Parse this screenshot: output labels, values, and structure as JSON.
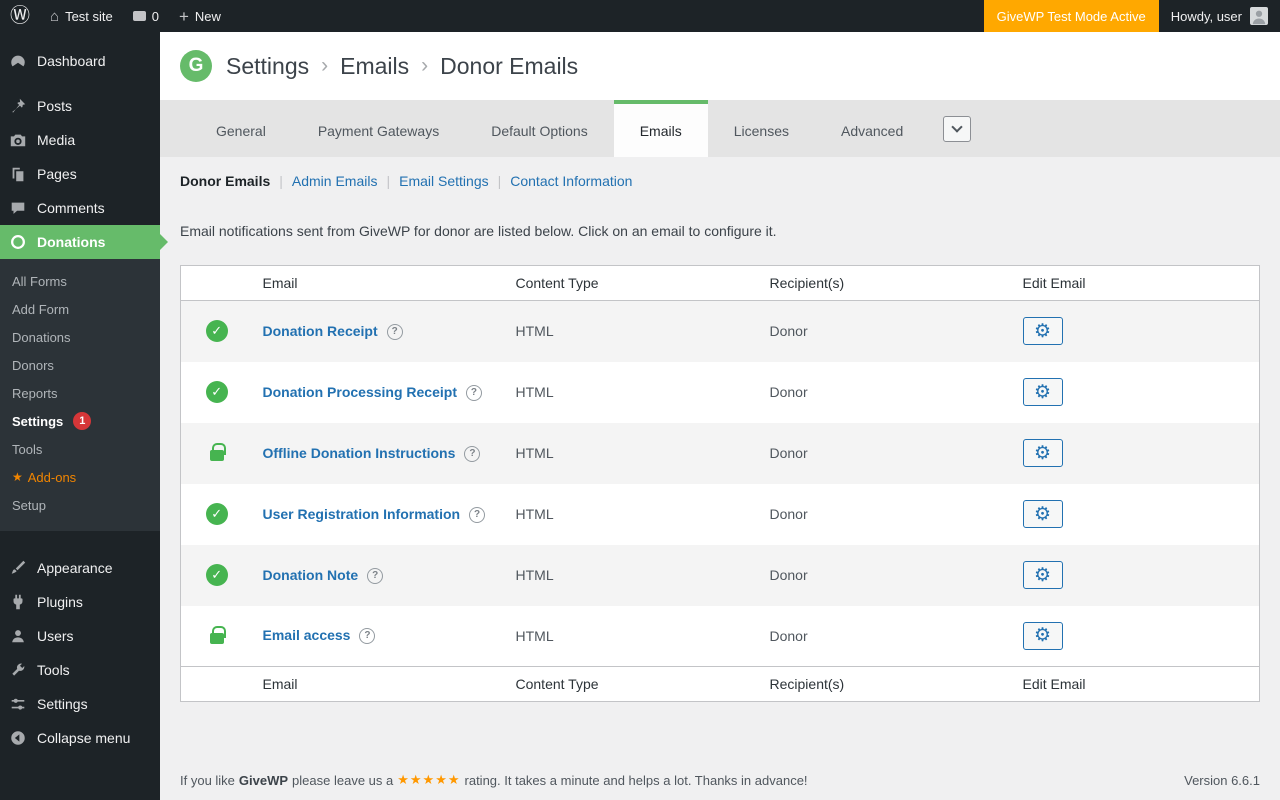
{
  "admin_bar": {
    "site_name": "Test site",
    "comments_count": "0",
    "new_label": "New",
    "test_mode_label": "GiveWP Test Mode Active",
    "howdy_label": "Howdy, user"
  },
  "sidebar": {
    "top_items": [
      "Dashboard",
      "Posts",
      "Media",
      "Pages",
      "Comments",
      "Donations"
    ],
    "submenu_items": [
      "All Forms",
      "Add Form",
      "Donations",
      "Donors",
      "Reports",
      "Settings",
      "Tools",
      "Add-ons",
      "Setup"
    ],
    "settings_update_count": "1",
    "bottom_items": [
      "Appearance",
      "Plugins",
      "Users",
      "Tools",
      "Settings"
    ],
    "collapse_label": "Collapse menu"
  },
  "header": {
    "logo_letter": "G",
    "breadcrumb": [
      "Settings",
      "Emails",
      "Donor Emails"
    ]
  },
  "tabs": {
    "items": [
      "General",
      "Payment Gateways",
      "Default Options",
      "Emails",
      "Licenses",
      "Advanced"
    ]
  },
  "subnav": {
    "items": [
      "Donor Emails",
      "Admin Emails",
      "Email Settings",
      "Contact Information"
    ]
  },
  "page": {
    "description": "Email notifications sent from GiveWP for donor are listed below. Click on an email to configure it."
  },
  "table": {
    "headers": [
      "Email",
      "Content Type",
      "Recipient(s)",
      "Edit Email"
    ],
    "rows": [
      {
        "name": "Donation Receipt",
        "status": "enabled",
        "content_type": "HTML",
        "recipients": "Donor"
      },
      {
        "name": "Donation Processing Receipt",
        "status": "enabled",
        "content_type": "HTML",
        "recipients": "Donor"
      },
      {
        "name": "Offline Donation Instructions",
        "status": "locked",
        "content_type": "HTML",
        "recipients": "Donor"
      },
      {
        "name": "User Registration Information",
        "status": "enabled",
        "content_type": "HTML",
        "recipients": "Donor"
      },
      {
        "name": "Donation Note",
        "status": "enabled",
        "content_type": "HTML",
        "recipients": "Donor"
      },
      {
        "name": "Email access",
        "status": "locked",
        "content_type": "HTML",
        "recipients": "Donor"
      }
    ]
  },
  "footer": {
    "pre_brand": "If you like",
    "brand": "GiveWP",
    "pre_stars": "please leave us a",
    "stars": "★★★★★",
    "post_stars": "rating. It takes a minute and helps a lot. Thanks in advance!",
    "version": "Version 6.6.1"
  },
  "icons": {
    "wp_logo": "Ⓦ",
    "home": "⌂",
    "plus": "+",
    "check": "✓",
    "star": "★",
    "gear": "⚙",
    "help": "?",
    "breadcrumb_separator": "›",
    "subnav_separator": "|"
  },
  "colors": {
    "accent_green": "#66bb6a",
    "status_green": "#46b450",
    "link_blue": "#2271b1",
    "test_mode_orange": "#ffa800",
    "update_badge_red": "#d63638",
    "addons_orange": "#f18500",
    "stars_orange": "#ff9800",
    "admin_dark": "#1d2327",
    "submenu_dark": "#2c3338"
  }
}
